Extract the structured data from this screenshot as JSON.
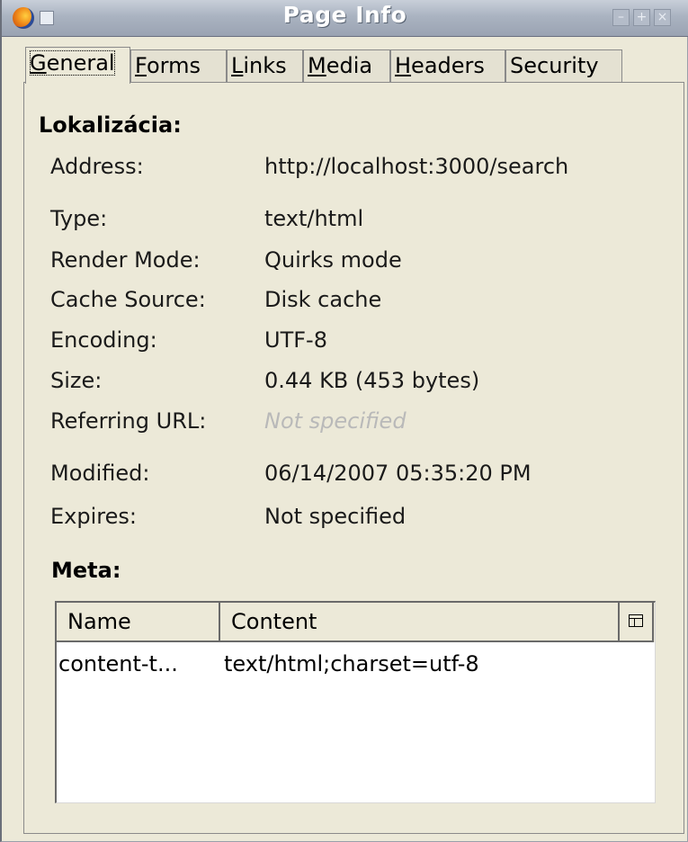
{
  "window": {
    "title": "Page Info"
  },
  "tabs": [
    {
      "pre": "",
      "mnemonic": "G",
      "post": "eneral"
    },
    {
      "pre": "",
      "mnemonic": "F",
      "post": "orms"
    },
    {
      "pre": "",
      "mnemonic": "L",
      "post": "inks"
    },
    {
      "pre": "",
      "mnemonic": "M",
      "post": "edia"
    },
    {
      "pre": "",
      "mnemonic": "H",
      "post": "eaders"
    },
    {
      "pre": "Security",
      "mnemonic": "",
      "post": ""
    }
  ],
  "general": {
    "section_title": "Lokalizácia:",
    "address_label": "Address:",
    "address_value": "http://localhost:3000/search",
    "type_label": "Type:",
    "type_value": "text/html",
    "render_mode_label": "Render Mode:",
    "render_mode_value": "Quirks mode",
    "cache_source_label": "Cache Source:",
    "cache_source_value": "Disk cache",
    "encoding_label": "Encoding:",
    "encoding_value": "UTF-8",
    "size_label": "Size:",
    "size_value": "0.44 KB (453 bytes)",
    "referring_url_label": "Referring URL:",
    "referring_url_value": "Not specified",
    "modified_label": "Modified:",
    "modified_value": "06/14/2007 05:35:20 PM",
    "expires_label": "Expires:",
    "expires_value": "Not specified"
  },
  "meta": {
    "section_title": "Meta:",
    "columns": [
      "Name",
      "Content"
    ],
    "rows": [
      {
        "name": "content-t...",
        "content": "text/html;charset=utf-8"
      }
    ]
  },
  "icons": {
    "app": "firefox-icon",
    "column_picker": "column-picker-icon"
  }
}
